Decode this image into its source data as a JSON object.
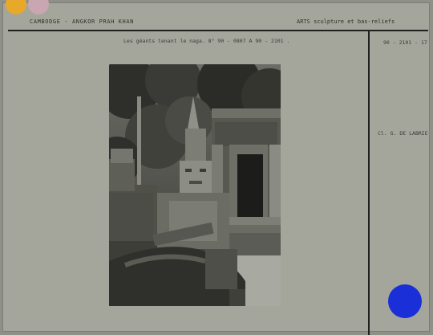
{
  "card": {
    "header_left": "CAMBODGE - ANGKOR PRAH KHAN",
    "header_right": "ARTS sculpture et bas-reliefs",
    "caption": "Les géants tenant le naga. 8°   90 - 0807  A      90 - 2101 .",
    "side_number": "90 - 2101 - 17",
    "side_credit": "Cl. G. DE LABRIE"
  },
  "photo": {
    "subject": "stone guardian statues holding naga before temple gate"
  },
  "colors": {
    "card": "#a4a69c",
    "rule": "#1f201c",
    "dot_yellow": "#e8a92a",
    "dot_pink": "#c9a6b2",
    "dot_blue": "#1a2fd8"
  }
}
